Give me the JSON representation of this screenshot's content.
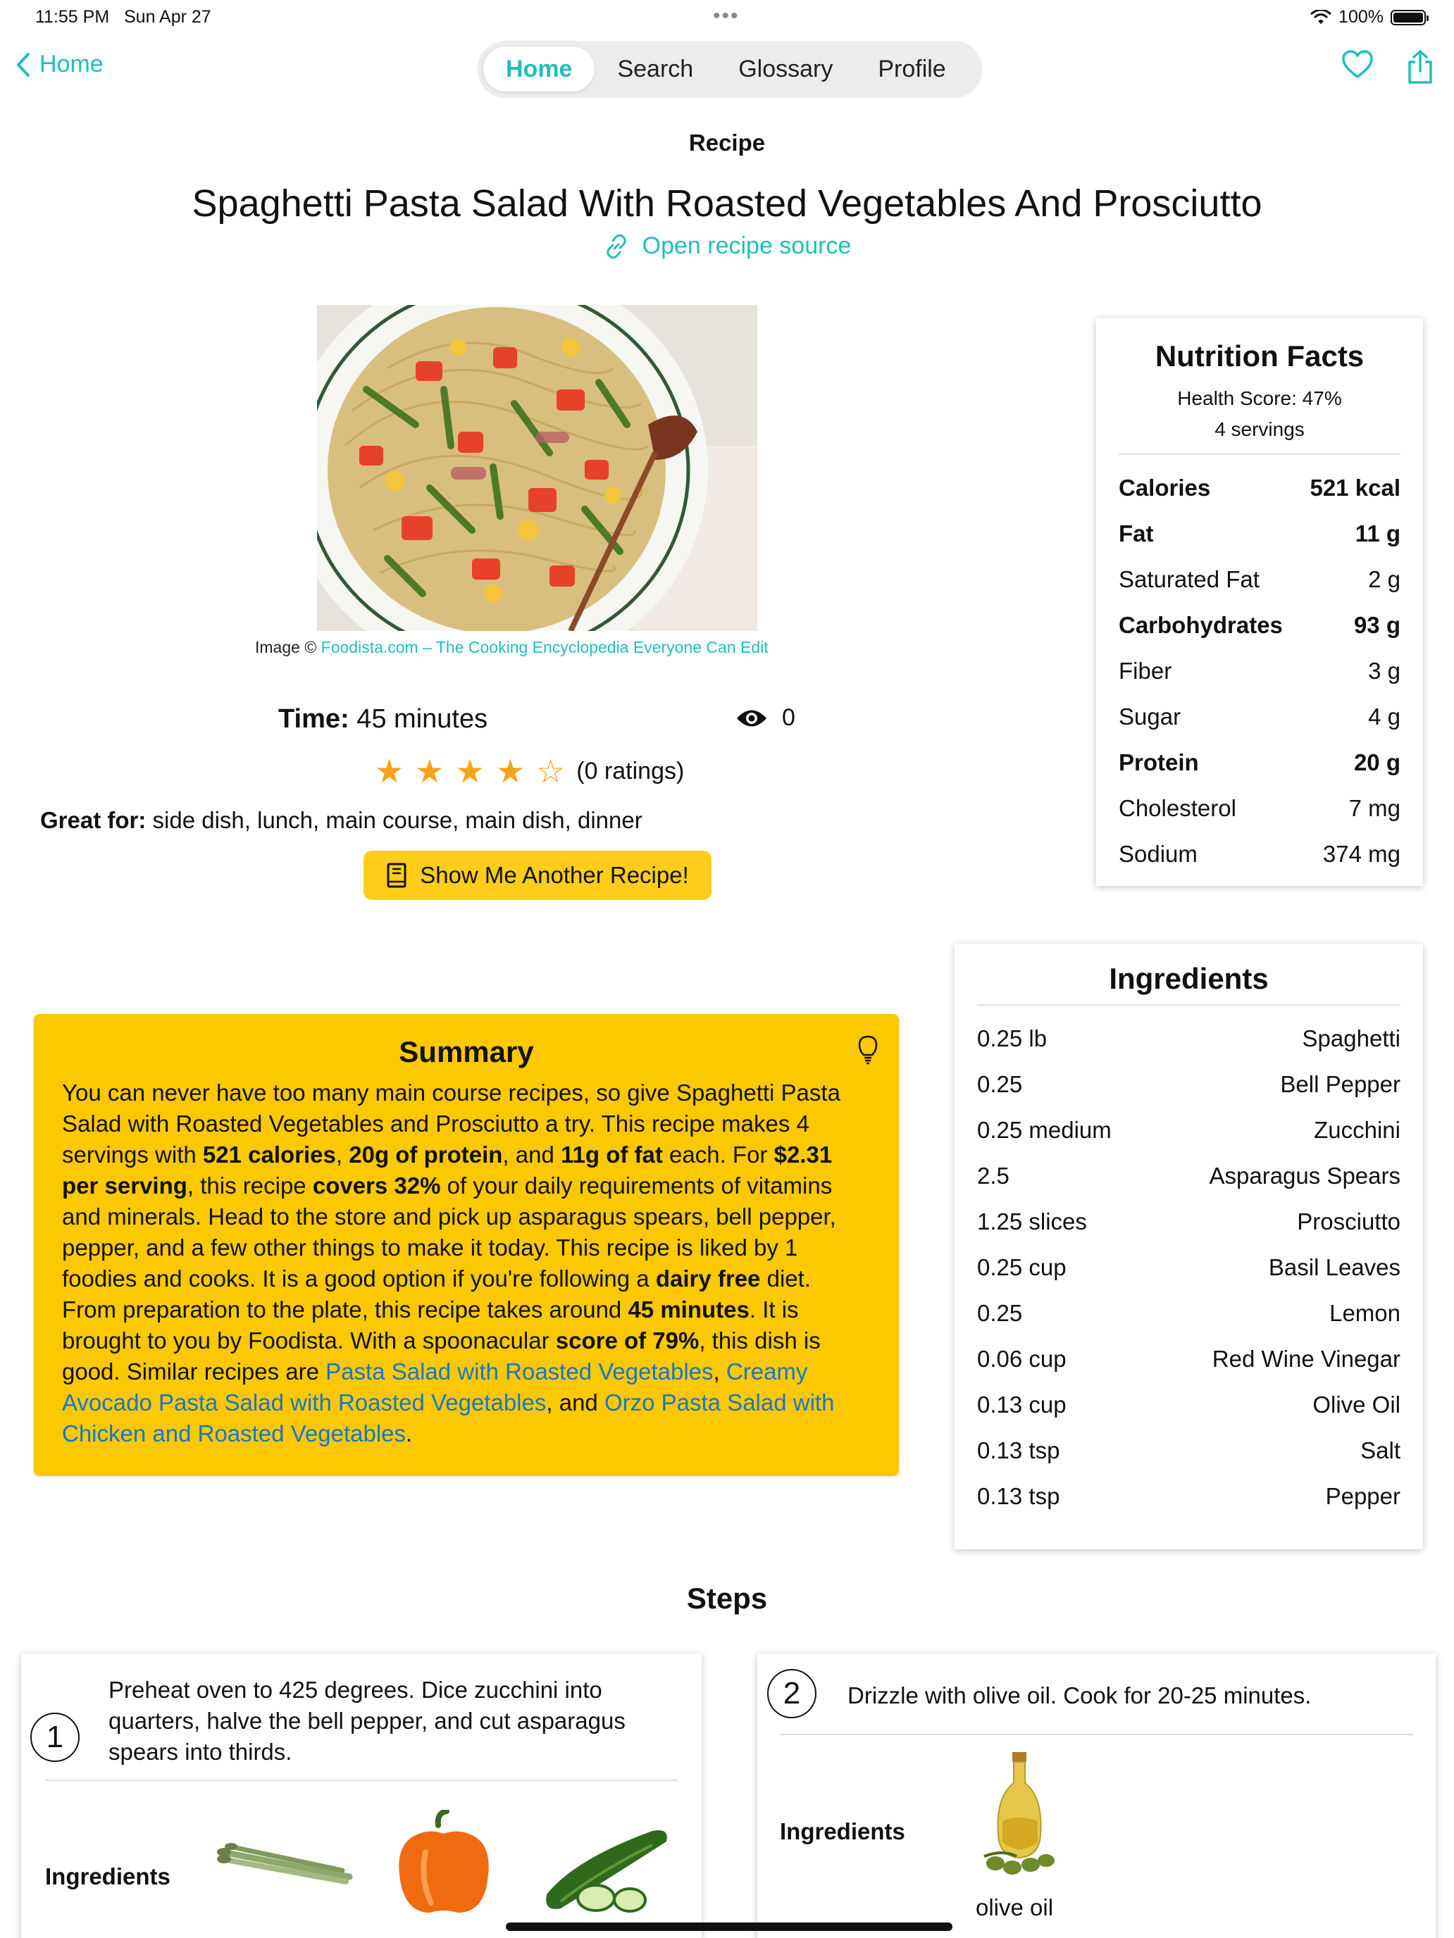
{
  "status_bar": {
    "time": "11:55 PM",
    "date": "Sun Apr 27",
    "battery": "100%"
  },
  "nav": {
    "back_label": "Home",
    "tabs": [
      {
        "label": "Home",
        "active": true
      },
      {
        "label": "Search",
        "active": false
      },
      {
        "label": "Glossary",
        "active": false
      },
      {
        "label": "Profile",
        "active": false
      }
    ],
    "icons": [
      "heart-icon",
      "share-icon"
    ],
    "title": "Recipe"
  },
  "recipe": {
    "title": "Spaghetti Pasta Salad With Roasted Vegetables And Prosciutto",
    "source_link": "Open recipe source",
    "image_credit_prefix": "Image ©",
    "image_credit_link": "Foodista.com – The Cooking Encyclopedia Everyone Can Edit",
    "time_label": "Time:",
    "time_value": "45 minutes",
    "views": "0",
    "rating": {
      "stars": 4,
      "max": 5,
      "text": "(0 ratings)"
    },
    "great_for_label": "Great for:",
    "great_for_value": "side dish, lunch, main course, main dish, dinner",
    "another_button": "Show Me Another Recipe!"
  },
  "nutrition": {
    "title": "Nutrition Facts",
    "health_score": "Health Score: 47%",
    "servings": "4 servings",
    "rows": [
      {
        "label": "Calories",
        "value": "521 kcal",
        "bold": true
      },
      {
        "label": "Fat",
        "value": "11 g",
        "bold": true
      },
      {
        "label": "Saturated Fat",
        "value": "2 g",
        "bold": false
      },
      {
        "label": "Carbohydrates",
        "value": "93 g",
        "bold": true
      },
      {
        "label": "Fiber",
        "value": "3 g",
        "bold": false
      },
      {
        "label": "Sugar",
        "value": "4 g",
        "bold": false
      },
      {
        "label": "Protein",
        "value": "20 g",
        "bold": true
      },
      {
        "label": "Cholesterol",
        "value": "7 mg",
        "bold": false
      },
      {
        "label": "Sodium",
        "value": "374 mg",
        "bold": false
      }
    ]
  },
  "ingredients": {
    "title": "Ingredients",
    "rows": [
      {
        "amount": "0.25 lb",
        "name": "Spaghetti"
      },
      {
        "amount": "0.25",
        "name": "Bell Pepper"
      },
      {
        "amount": "0.25 medium",
        "name": "Zucchini"
      },
      {
        "amount": "2.5",
        "name": "Asparagus Spears"
      },
      {
        "amount": "1.25 slices",
        "name": "Prosciutto"
      },
      {
        "amount": "0.25 cup",
        "name": "Basil Leaves"
      },
      {
        "amount": "0.25",
        "name": "Lemon"
      },
      {
        "amount": "0.06 cup",
        "name": "Red Wine Vinegar"
      },
      {
        "amount": "0.13 cup",
        "name": "Olive Oil"
      },
      {
        "amount": "0.13 tsp",
        "name": "Salt"
      },
      {
        "amount": "0.13 tsp",
        "name": "Pepper"
      }
    ]
  },
  "summary": {
    "title": "Summary",
    "t1": "You can never have too many main course recipes, so give Spaghetti Pasta Salad with Roasted Vegetables and Prosciutto a try. This recipe makes 4 servings with ",
    "b1": "521 calories",
    "t2": ", ",
    "b2": "20g of protein",
    "t3": ", and ",
    "b3": "11g of fat",
    "t4": " each. For ",
    "b4": "$2.31 per serving",
    "t5": ", this recipe ",
    "b5": "covers 32%",
    "t6": " of your daily requirements of vitamins and minerals. Head to the store and pick up asparagus spears, bell pepper, pepper, and a few other things to make it today. This recipe is liked by 1 foodies and cooks. It is a good option if you're following a ",
    "b6": "dairy free",
    "t7": " diet. From preparation to the plate, this recipe takes around ",
    "b7": "45 minutes",
    "t8": ". It is brought to you by Foodista. With a spoonacular ",
    "b8": "score of 79%",
    "t9": ", this dish is good. Similar recipes are ",
    "l1": "Pasta Salad with Roasted Vegetables",
    "t10": ", ",
    "l2": "Creamy Avocado Pasta Salad with Roasted Vegetables",
    "t11": ", and ",
    "l3": "Orzo Pasta Salad with Chicken and Roasted Vegetables",
    "t12": "."
  },
  "steps": {
    "title": "Steps",
    "items": [
      {
        "number": "1",
        "text": "Preheat oven to 425 degrees. Dice zucchini into quarters, halve the bell pepper, and cut asparagus spears into thirds.",
        "ingredients_label": "Ingredients",
        "ingredient_icons": [
          "asparagus-icon",
          "bell-pepper-icon",
          "zucchini-icon"
        ]
      },
      {
        "number": "2",
        "text": "Drizzle with olive oil. Cook for 20-25 minutes.",
        "ingredients_label": "Ingredients",
        "ingredient_icons": [
          "olive-oil-icon"
        ],
        "ingredient_names": [
          "olive oil"
        ]
      }
    ]
  },
  "colors": {
    "accent": "#1fbfb8",
    "summary_bg": "#fcc800",
    "button_bg": "#ffcd1a",
    "link": "#1677c9",
    "star": "#f6a21a"
  }
}
